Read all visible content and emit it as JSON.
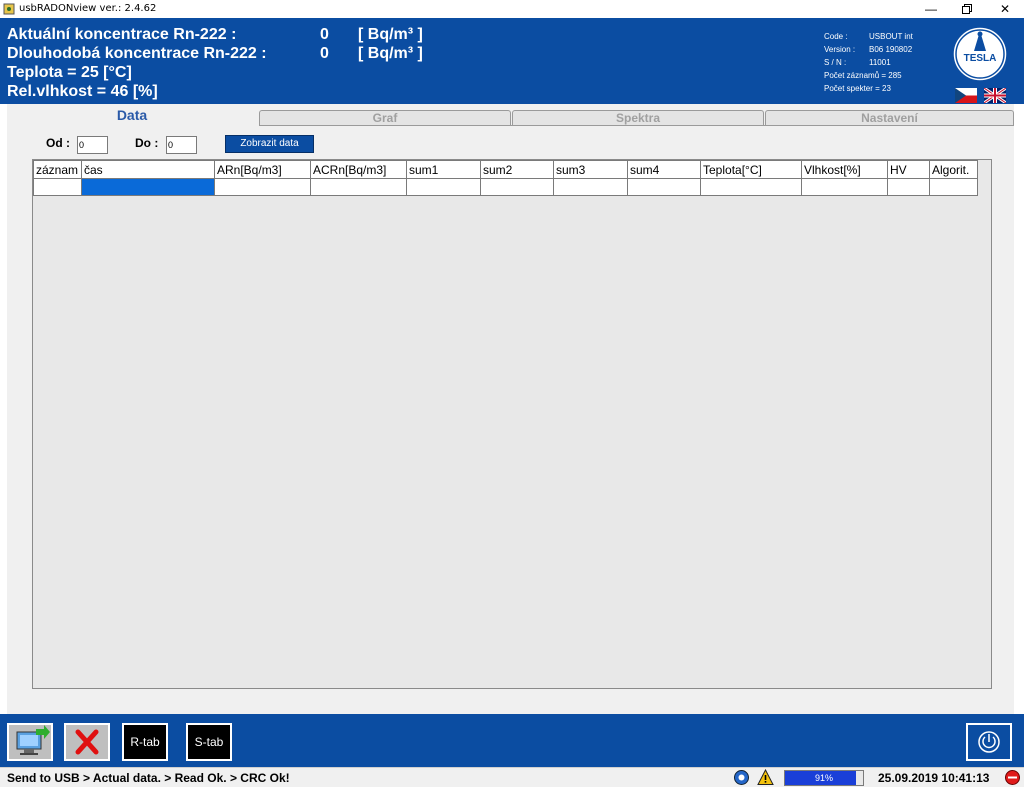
{
  "window": {
    "title": "usbRADONview ver.: 2.4.62",
    "min_icon": "minimize-icon",
    "restore_icon": "restore-icon",
    "close_icon": "close-icon"
  },
  "header": {
    "actual_label": "Aktuální koncentrace Rn-222 :",
    "actual_value": "0",
    "actual_unit": "[ Bq/m³ ]",
    "longterm_label": "Dlouhodobá koncentrace Rn-222 :",
    "longterm_value": "0",
    "longterm_unit": "[ Bq/m³ ]",
    "temperature": "Teplota = 25  [°C]",
    "humidity": "Rel.vlhkost = 46  [%]",
    "info": {
      "code_label": "Code :",
      "code_value": "USBOUT int",
      "version_label": "Version :",
      "version_value": "B06 190802",
      "sn_label": "S / N :",
      "sn_value": "11001",
      "records": "Počet záznamů = 285",
      "spectra": "Počet spekter = 23"
    },
    "logo_text": "TESLA",
    "flags": [
      "czech-flag-icon",
      "uk-flag-icon"
    ],
    "accent": "#0b4da2"
  },
  "tabs": [
    {
      "label": "Data",
      "active": true
    },
    {
      "label": "Graf",
      "active": false
    },
    {
      "label": "Spektra",
      "active": false
    },
    {
      "label": "Nastavení",
      "active": false
    }
  ],
  "filter": {
    "from_label": "Od :",
    "from_value": "0",
    "to_label": "Do :",
    "to_value": "0",
    "show_button": "Zobrazit data"
  },
  "table": {
    "columns": [
      "záznam",
      "čas",
      "ARn[Bq/m3]",
      "ACRn[Bq/m3]",
      "sum1",
      "sum2",
      "sum3",
      "sum4",
      "Teplota[°C]",
      "Vlhkost[%]",
      "HV",
      "Algorit."
    ],
    "rows": [
      [
        "",
        "",
        "",
        "",
        "",
        "",
        "",
        "",
        "",
        "",
        "",
        ""
      ]
    ],
    "selected_color": "#0a6ad8"
  },
  "footer": {
    "export_icon": "export-monitor-icon",
    "delete_icon": "red-x-icon",
    "rtab_label": "R-tab",
    "stab_label": "S-tab",
    "power_icon": "power-icon"
  },
  "status": {
    "message": "Send to USB > Actual data. > Read Ok. > CRC Ok!",
    "progress_percent": 91,
    "progress_label": "91%",
    "datetime": "25.09.2019 10:41:13",
    "icons": [
      "gear-icon",
      "warning-icon",
      "red-stop-icon"
    ]
  }
}
